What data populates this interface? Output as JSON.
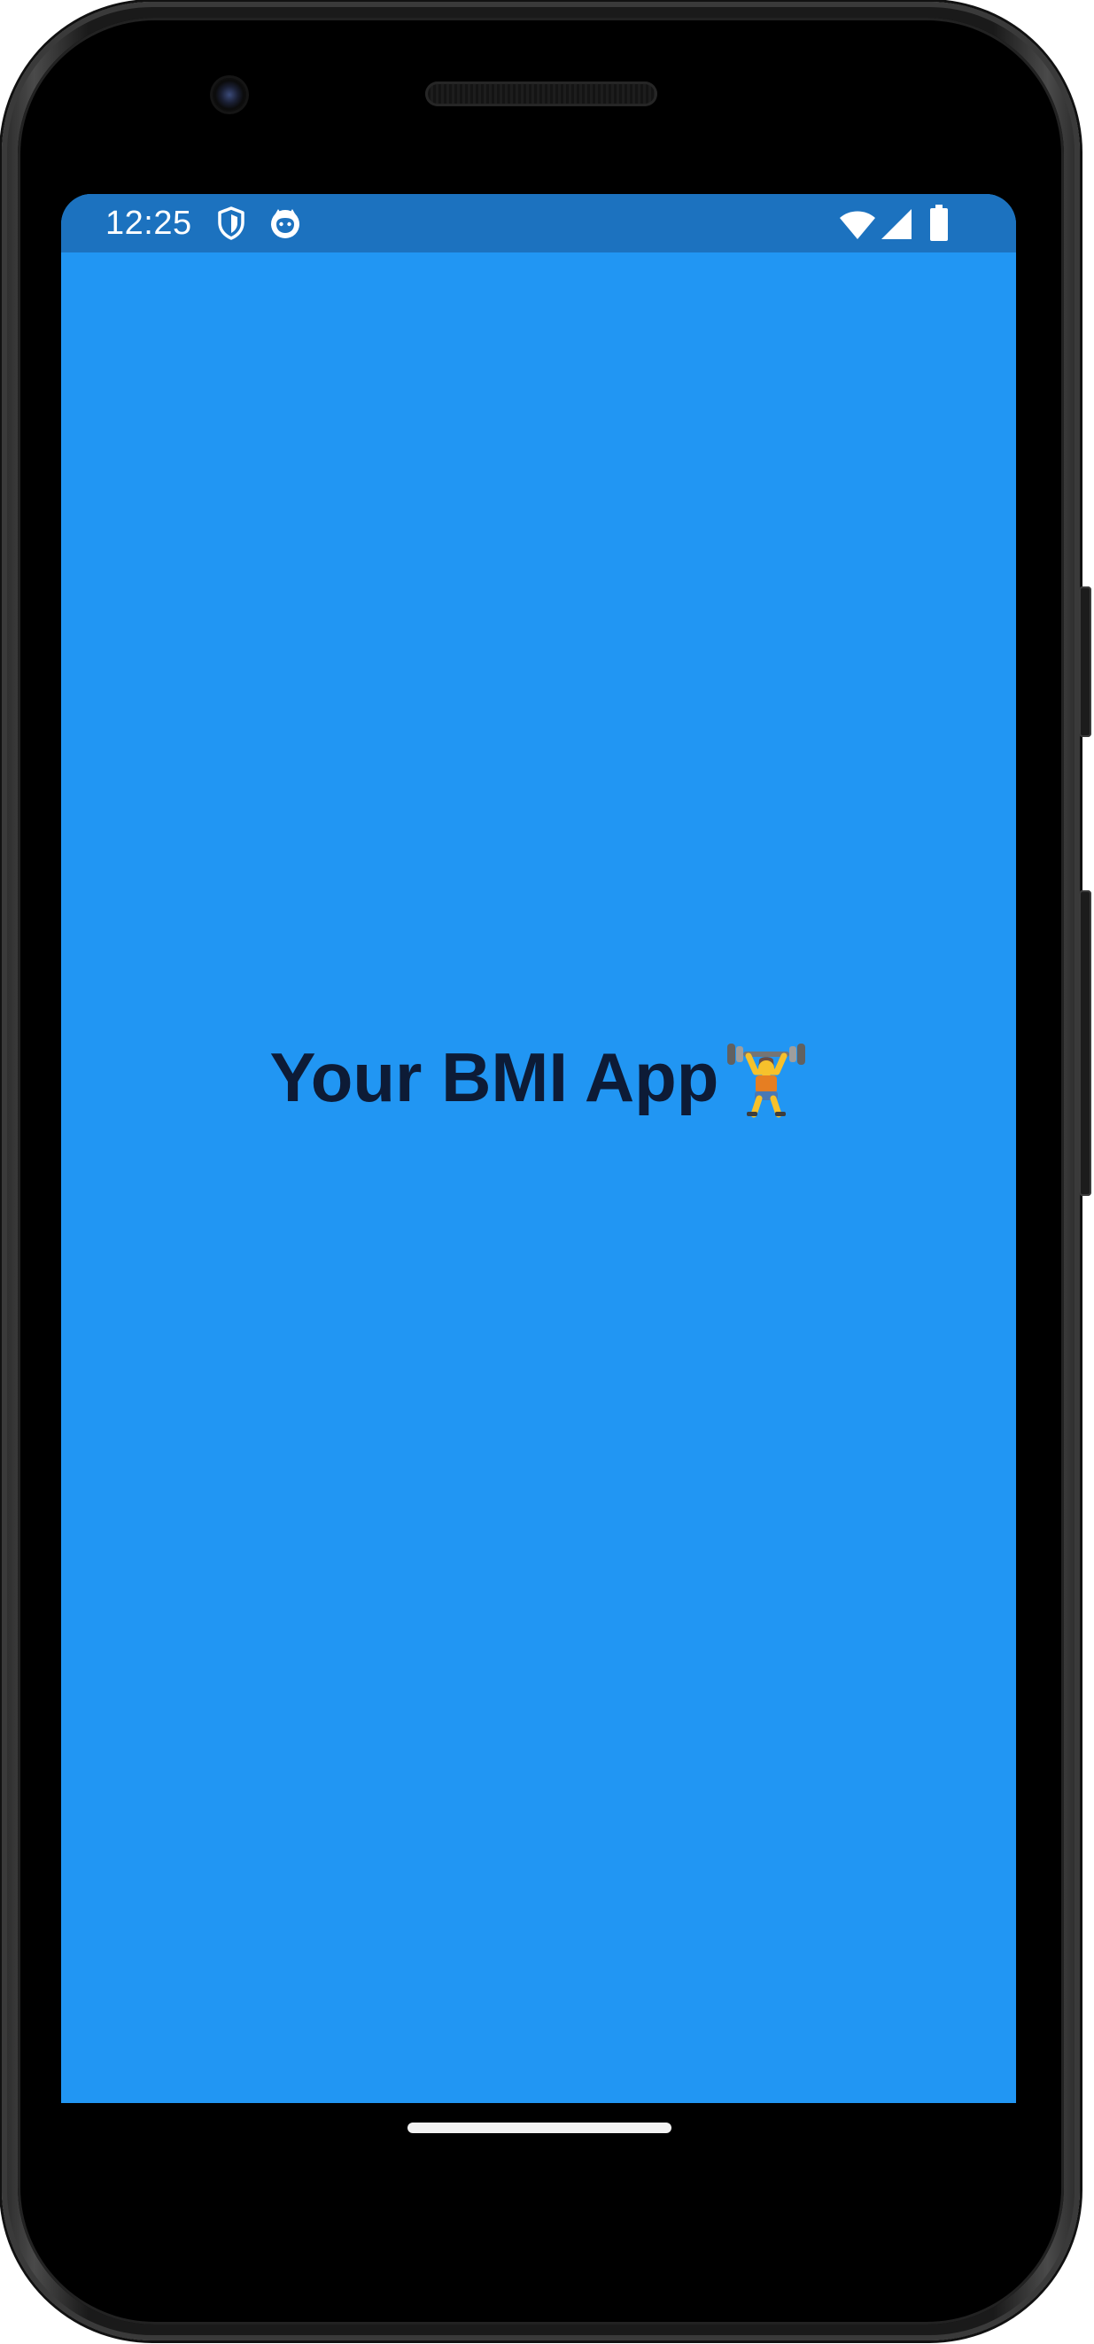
{
  "status_bar": {
    "time": "12:25",
    "left_icons": [
      "shield-icon",
      "cat-face-icon"
    ],
    "right_icons": [
      "wifi-icon",
      "cell-signal-icon",
      "battery-icon"
    ]
  },
  "app": {
    "title": "Your BMI App",
    "title_emoji_icon": "weightlifter-icon",
    "background_color": "#2196f3",
    "status_bar_color": "#1c72bf",
    "title_color": "#0d1b36"
  },
  "device": {
    "nav_handle": "home-gesture-bar"
  }
}
